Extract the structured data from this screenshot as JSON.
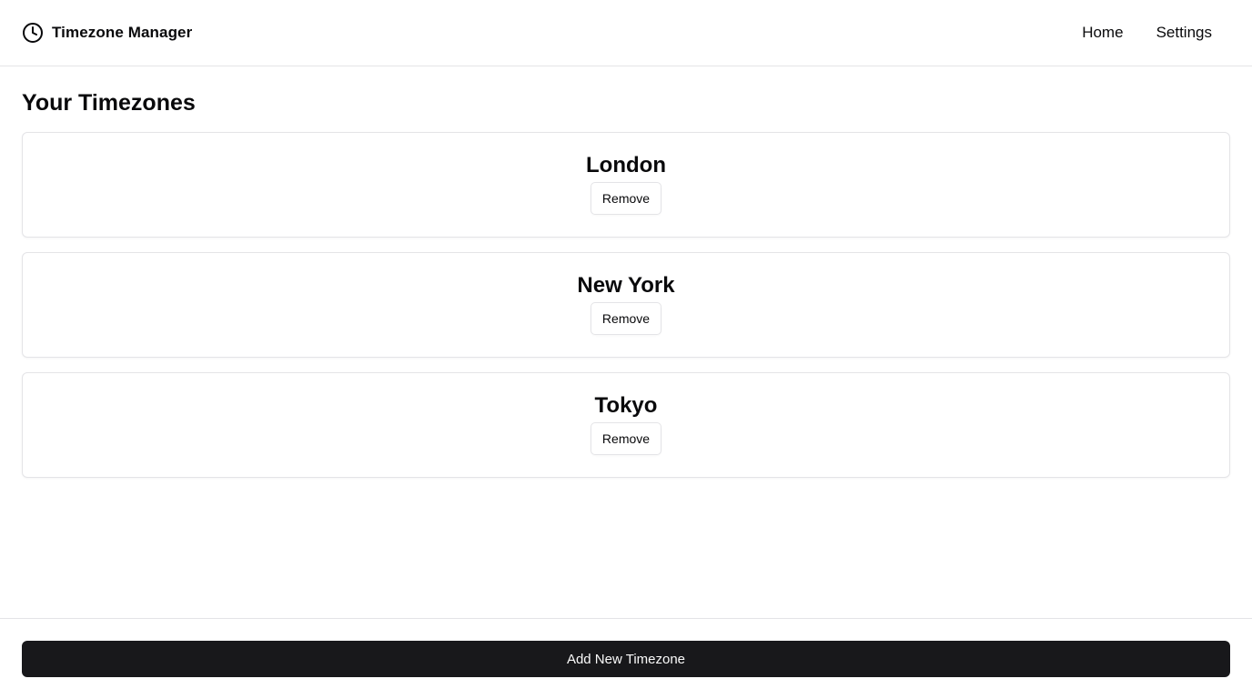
{
  "header": {
    "brand_icon": "clock-icon",
    "title": "Timezone Manager",
    "nav": [
      {
        "label": "Home"
      },
      {
        "label": "Settings"
      }
    ]
  },
  "main": {
    "title": "Your Timezones",
    "timezones": [
      {
        "name": "London",
        "remove_label": "Remove"
      },
      {
        "name": "New York",
        "remove_label": "Remove"
      },
      {
        "name": "Tokyo",
        "remove_label": "Remove"
      }
    ]
  },
  "footer": {
    "add_label": "Add New Timezone"
  },
  "colors": {
    "primary_button_bg": "#18181b",
    "primary_button_text": "#fafafa",
    "border": "#e4e4e7",
    "text": "#09090b"
  }
}
